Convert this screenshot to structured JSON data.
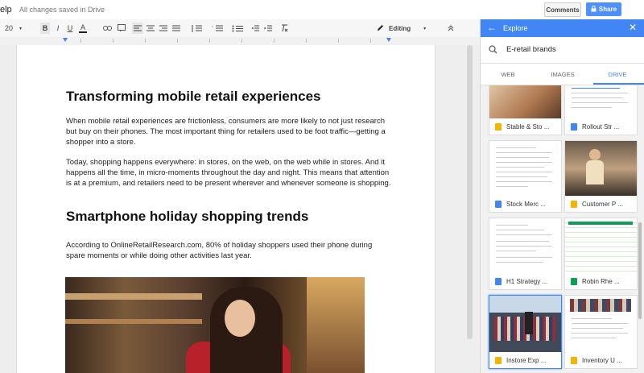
{
  "app": {
    "menu_fragment": "elp",
    "save_status": "All changes saved in Drive"
  },
  "header": {
    "comments_label": "Comments",
    "share_label": "Share"
  },
  "toolbar": {
    "font_size": "20",
    "bold": "B",
    "italic": "I",
    "underline": "U",
    "text_color": "A",
    "mode_label": "Editing"
  },
  "document": {
    "heading1": "Transforming mobile retail experiences",
    "para1": "When mobile retail experiences are frictionless, consumers are more likely to not just research but buy on their phones. The most important thing for retailers used to be foot traffic—getting a shopper into a store.",
    "para2": "Today, shopping happens everywhere: in stores, on the web, on the web while in stores. And it happens all the time, in micro-moments throughout the day and night. This means that attention is at a premium, and retailers need to be present wherever and whenever someone is shopping.",
    "heading2": "Smartphone holiday shopping trends",
    "para3": "According to OnlineRetailResearch.com, 80% of holiday shoppers used their phone during spare moments or while doing other activities last year."
  },
  "explore": {
    "title": "Explore",
    "query": "E-retail brands",
    "tabs": [
      "WEB",
      "IMAGES",
      "DRIVE"
    ],
    "active_tab": "DRIVE",
    "results": [
      {
        "label": "Stable & Sto ...",
        "type": "slides",
        "color": "#f4b400"
      },
      {
        "label": "Rollout Str ...",
        "type": "docs",
        "color": "#4285f4"
      },
      {
        "label": "Stock Merc ...",
        "type": "docs",
        "color": "#4285f4"
      },
      {
        "label": "Customer P ...",
        "type": "slides",
        "color": "#f4b400"
      },
      {
        "label": "H1 Strategy ...",
        "type": "docs",
        "color": "#4285f4"
      },
      {
        "label": "Robin Rhe ...",
        "type": "sheets",
        "color": "#0f9d58"
      },
      {
        "label": "Instore Exp ...",
        "type": "slides",
        "color": "#f4b400"
      },
      {
        "label": "Inventory U ...",
        "type": "slides",
        "color": "#f4b400"
      }
    ]
  }
}
